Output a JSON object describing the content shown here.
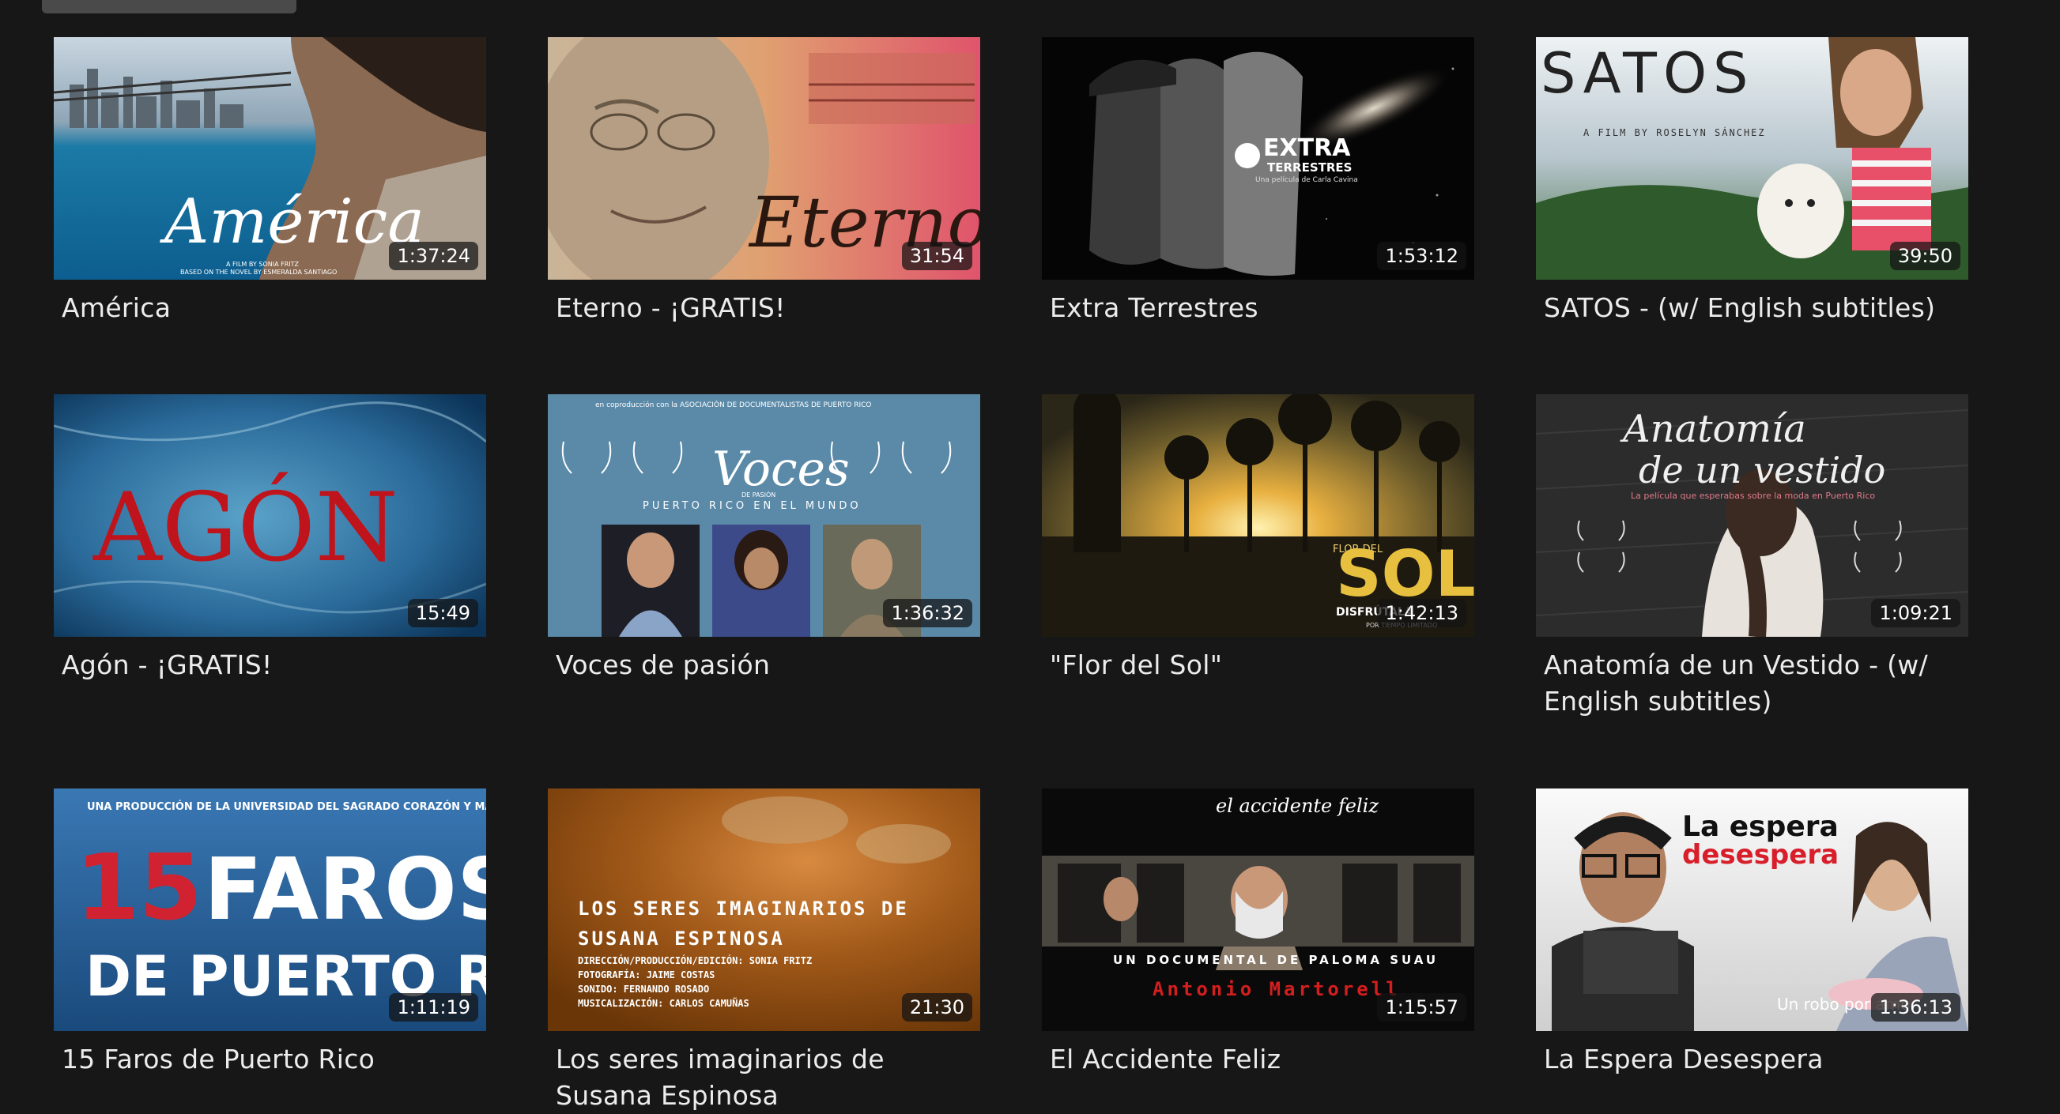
{
  "videos": [
    {
      "title": "América",
      "duration": "1:37:24",
      "thumb_text": [
        "América",
        "A FILM BY SONIA FRITZ",
        "BASED ON THE NOVEL BY ESMERALDA SANTIAGO"
      ]
    },
    {
      "title": "Eterno - ¡GRATIS!",
      "duration": "31:54",
      "thumb_text": [
        "Eterno"
      ]
    },
    {
      "title": "Extra Terrestres",
      "duration": "1:53:12",
      "thumb_text": [
        "EXTRA",
        "TERRESTRES",
        "Una película de Carla Cavina"
      ]
    },
    {
      "title": "SATOS - (w/ English subtitles)",
      "duration": "39:50",
      "thumb_text": [
        "SATOS",
        "A FILM BY ROSELYN SÁNCHEZ"
      ]
    },
    {
      "title": "Agón - ¡GRATIS!",
      "duration": "15:49",
      "thumb_text": [
        "AGÓN"
      ]
    },
    {
      "title": "Voces de pasión",
      "duration": "1:36:32",
      "thumb_text": [
        "Voces",
        "DE PASIÓN",
        "PUERTO RICO EN EL MUNDO",
        "en coproducción con la ASOCIACIÓN DE DOCUMENTALISTAS DE PUERTO RICO"
      ]
    },
    {
      "title": "\"Flor del Sol\"",
      "duration": "1:42:13",
      "thumb_text": [
        "FLOR DEL",
        "SOL",
        "DISFRÚTALA",
        "POR TIEMPO LIMITADO"
      ]
    },
    {
      "title": "Anatomía de un Vestido - (w/ English subtitles)",
      "duration": "1:09:21",
      "thumb_text": [
        "Anatomía",
        "de un vestido",
        "La película que esperabas sobre la moda en Puerto Rico"
      ]
    },
    {
      "title": "15 Faros de Puerto Rico",
      "duration": "1:11:19",
      "thumb_text": [
        "UNA PRODUCCIÓN DE LA UNIVERSIDAD DEL SAGRADO CORAZÓN Y MARINA FILMS",
        "15",
        "FAROS",
        "DE PUERTO RICO"
      ]
    },
    {
      "title": "Los seres imaginarios de Susana Espinosa",
      "duration": "21:30",
      "thumb_text": [
        "LOS SERES IMAGINARIOS DE",
        "SUSANA ESPINOSA",
        "DIRECCIÓN/PRODUCCIÓN/EDICIÓN: SONIA FRITZ",
        "FOTOGRAFÍA: JAIME COSTAS",
        "SONIDO: FERNANDO ROSADO",
        "MUSICALIZACIÓN: CARLOS CAMUÑAS"
      ]
    },
    {
      "title": "El Accidente Feliz",
      "duration": "1:15:57",
      "thumb_text": [
        "el accidente feliz",
        "UN DOCUMENTAL DE PALOMA SUAU",
        "Antonio Martorell"
      ]
    },
    {
      "title": "La Espera Desespera",
      "duration": "1:36:13",
      "thumb_text": [
        "La espera",
        "desespera",
        "Un robo por amor"
      ]
    }
  ],
  "colors": {
    "background": "#171717",
    "text": "#ececec"
  }
}
